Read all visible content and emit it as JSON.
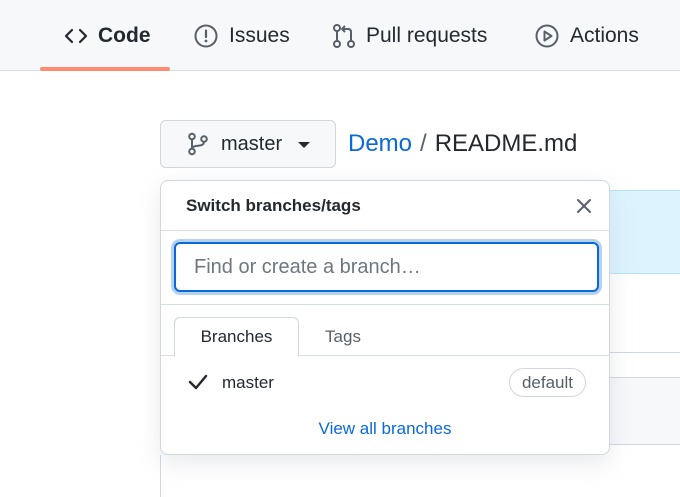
{
  "nav": {
    "tabs": [
      {
        "label": "Code",
        "icon": "code-icon",
        "active": true
      },
      {
        "label": "Issues",
        "icon": "issue-opened-icon",
        "active": false
      },
      {
        "label": "Pull requests",
        "icon": "git-pull-request-icon",
        "active": false
      },
      {
        "label": "Actions",
        "icon": "play-icon",
        "active": false
      }
    ],
    "active_color": "#fd8c73"
  },
  "branch_button": {
    "label": "master",
    "icon": "git-branch-icon"
  },
  "breadcrumb": {
    "repo": "Demo",
    "separator": "/",
    "file": "README.md"
  },
  "dropdown": {
    "title": "Switch branches/tags",
    "filter": {
      "value": "",
      "placeholder": "Find or create a branch…"
    },
    "tabs": [
      {
        "label": "Branches",
        "active": true
      },
      {
        "label": "Tags",
        "active": false
      }
    ],
    "branches": [
      {
        "name": "master",
        "selected": true,
        "badge": "default"
      }
    ],
    "view_all_label": "View all branches"
  },
  "colors": {
    "link": "#0969da",
    "focus": "#0969da",
    "text": "#24292f",
    "muted": "#57606a"
  }
}
